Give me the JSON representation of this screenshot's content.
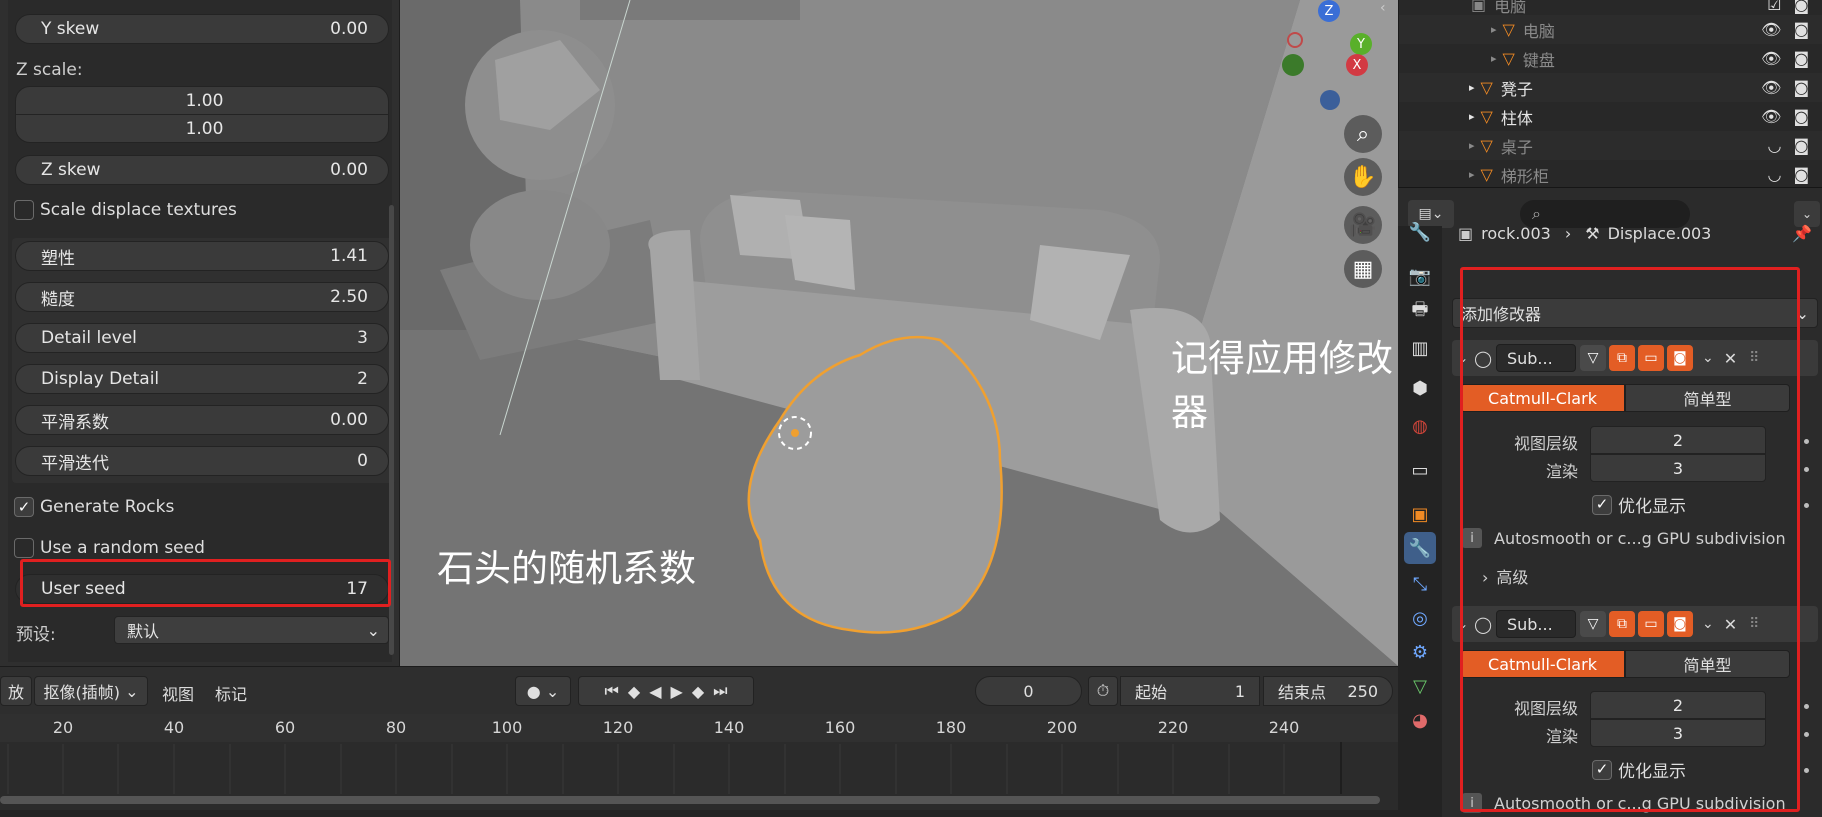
{
  "left_panel": {
    "y_skew": {
      "label": "Y skew",
      "value": "0.00"
    },
    "z_scale_label": "Z scale:",
    "z_scale_values": [
      "1.00",
      "1.00"
    ],
    "z_skew": {
      "label": "Z skew",
      "value": "0.00"
    },
    "scale_displace_textures": {
      "label": "Scale displace textures",
      "checked": false
    },
    "plasticity": {
      "label": "塑性",
      "value": "1.41"
    },
    "roughness": {
      "label": "糙度",
      "value": "2.50"
    },
    "detail_level": {
      "label": "Detail level",
      "value": "3"
    },
    "display_detail": {
      "label": "Display Detail",
      "value": "2"
    },
    "smooth_factor": {
      "label": "平滑系数",
      "value": "0.00"
    },
    "smooth_iterations": {
      "label": "平滑迭代",
      "value": "0"
    },
    "generate_rocks": {
      "label": "Generate Rocks",
      "checked": true
    },
    "random_seed": {
      "label": "Use a random seed",
      "checked": false
    },
    "user_seed": {
      "label": "User seed",
      "value": "17"
    },
    "preset": {
      "label": "预设:",
      "value": "默认"
    }
  },
  "annotations": {
    "seed_note": "石头的随机系数",
    "apply_note": "记得应用修改器"
  },
  "viewport": {
    "gizmo_axes": [
      "Z",
      "Y",
      "X"
    ],
    "nav_icons": [
      "zoom-icon",
      "hand-pan-icon",
      "camera-icon",
      "grid-perspective-icon"
    ]
  },
  "timeline": {
    "mode_label": "放",
    "keying_label": "抠像(插帧)",
    "view_label": "视图",
    "marker_label": "标记",
    "current_frame": "0",
    "start_label": "起始",
    "start_value": "1",
    "end_label": "结束点",
    "end_value": "250",
    "ruler_ticks": [
      "20",
      "40",
      "60",
      "80",
      "100",
      "120",
      "140",
      "160",
      "180",
      "200",
      "220",
      "240"
    ]
  },
  "outliner": {
    "rows": [
      {
        "name": "电脑",
        "indent": 1,
        "dim": true
      },
      {
        "name": "电脑",
        "indent": 2,
        "dim": true
      },
      {
        "name": "键盘",
        "indent": 2,
        "dim": true
      },
      {
        "name": "凳子",
        "indent": 1,
        "dim": false
      },
      {
        "name": "柱体",
        "indent": 1,
        "dim": false
      },
      {
        "name": "桌子",
        "indent": 1,
        "dim": true
      },
      {
        "name": "梯形柜",
        "indent": 1,
        "dim": true
      }
    ]
  },
  "properties": {
    "breadcrumb_object": "rock.003",
    "breadcrumb_modifier": "Displace.003",
    "add_modifier_label": "添加修改器",
    "modifiers": [
      {
        "name": "Sub...",
        "algo_active": "Catmull-Clark",
        "algo_inactive": "简单型",
        "viewport_label": "视图层级",
        "viewport_value": "2",
        "render_label": "渲染",
        "render_value": "3",
        "optimal_label": "优化显示",
        "info_text": "Autosmooth or c...g GPU subdivision",
        "advanced_label": "高级"
      },
      {
        "name": "Sub...",
        "algo_active": "Catmull-Clark",
        "algo_inactive": "简单型",
        "viewport_label": "视图层级",
        "viewport_value": "2",
        "render_label": "渲染",
        "render_value": "3",
        "optimal_label": "优化显示",
        "info_text": "Autosmooth or c...g GPU subdivision"
      }
    ]
  },
  "colors": {
    "accent_orange": "#e35d25",
    "selection_outline": "#f0a030",
    "annotation_red": "#e02020"
  }
}
